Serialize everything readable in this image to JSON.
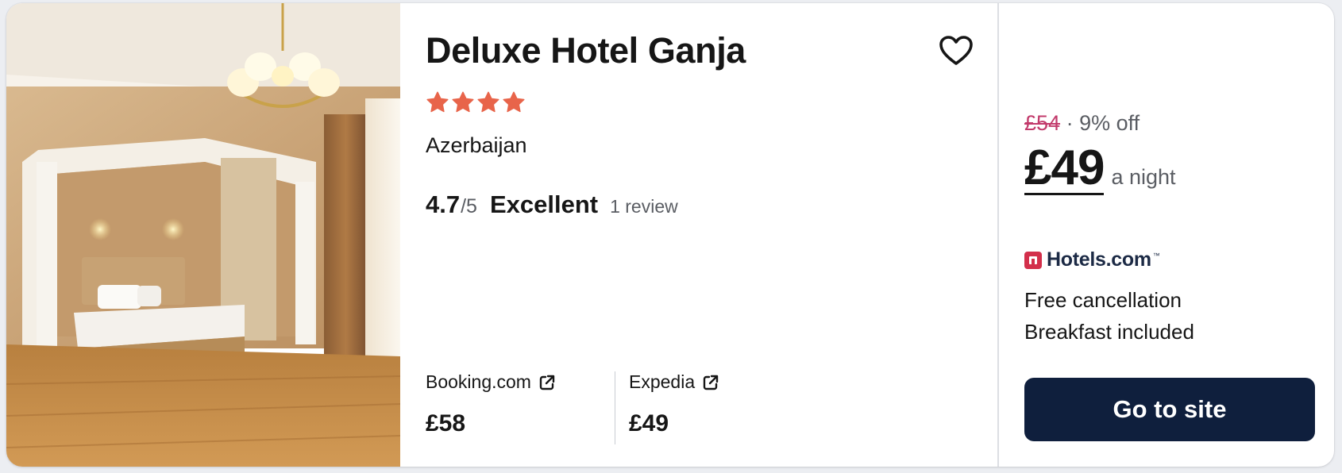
{
  "hotel": {
    "name": "Deluxe Hotel Ganja",
    "star_rating": 4,
    "location": "Azerbaijan",
    "score": "4.7",
    "score_out_of": "/5",
    "score_label": "Excellent",
    "review_count": "1 review"
  },
  "providers": [
    {
      "name": "Booking.com",
      "price": "£58",
      "icon": "external-link-icon"
    },
    {
      "name": "Expedia",
      "price": "£49",
      "icon": "external-link-icon"
    }
  ],
  "deal": {
    "original_price": "£54",
    "separator": "·",
    "discount": "9% off",
    "price": "£49",
    "per": "a night",
    "provider": "Hotels.com",
    "provider_tm": "™",
    "perks": [
      "Free cancellation",
      "Breakfast included"
    ],
    "cta": "Go to site"
  },
  "colors": {
    "star": "#e8644a",
    "cta_bg": "#0f1f3d",
    "strike_price": "#c23a6b",
    "provider_logo": "#d32f4b"
  },
  "icons": {
    "favorite": "heart-icon",
    "star": "star-icon",
    "external": "external-link-icon"
  }
}
